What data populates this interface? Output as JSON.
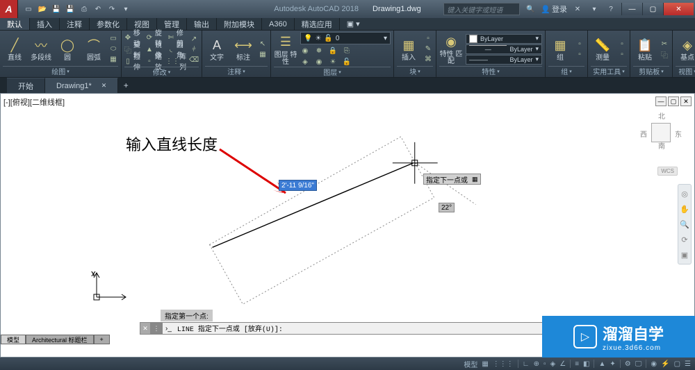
{
  "title": {
    "app": "Autodesk AutoCAD 2018",
    "doc": "Drawing1.dwg",
    "search_placeholder": "键入关键字或短语",
    "login": "登录"
  },
  "menutabs": [
    "默认",
    "插入",
    "注释",
    "参数化",
    "视图",
    "管理",
    "输出",
    "附加模块",
    "A360",
    "精选应用"
  ],
  "ribbon": {
    "draw": {
      "label": "绘图",
      "line": "直线",
      "polyline": "多段线",
      "circle": "圆",
      "arc": "圆弧"
    },
    "modify": {
      "label": "修改",
      "r1": [
        "移动",
        "旋转",
        "修剪"
      ],
      "r2": [
        "复制",
        "镜像",
        "圆角"
      ],
      "r3": [
        "拉伸",
        "缩放",
        "阵列"
      ]
    },
    "annotation": {
      "label": "注释",
      "text": "文字",
      "dim": "标注"
    },
    "layers": {
      "label": "图层",
      "props": "图层 特性",
      "current": "0"
    },
    "block": {
      "label": "块",
      "insert": "插入"
    },
    "properties": {
      "label": "特性",
      "match": "特性 匹配",
      "bylayer1": "ByLayer",
      "bylayer2": "ByLayer",
      "bylayer3": "ByLayer"
    },
    "group": {
      "label": "组",
      "btn": "组"
    },
    "utilities": {
      "label": "实用工具",
      "measure": "测量"
    },
    "clipboard": {
      "label": "剪贴板",
      "paste": "粘贴"
    },
    "view": {
      "label": "视图",
      "base": "基点"
    }
  },
  "doctabs": {
    "start": "开始",
    "active": "Drawing1*"
  },
  "viewport": {
    "label": "[-][俯视][二维线框]"
  },
  "viewcube": {
    "n": "北",
    "e": "东",
    "s": "南",
    "w": "西",
    "wcs": "WCS"
  },
  "annotation": {
    "text": "输入直线长度"
  },
  "dyninput": {
    "length": "2'-11 9/16\"",
    "prompt": "指定下一点或",
    "angle": "22°"
  },
  "ucs": {
    "x": "X",
    "y": "Y"
  },
  "cmdline": {
    "hist": "指定第一个点:",
    "text": "LINE 指定下一点或 [放弃(U)]:"
  },
  "layout_tabs": [
    "模型",
    "Architectural 标题栏"
  ],
  "statusbar": {
    "model": "模型"
  },
  "watermark": {
    "main": "溜溜自学",
    "sub": "zixue.3d66.com"
  }
}
